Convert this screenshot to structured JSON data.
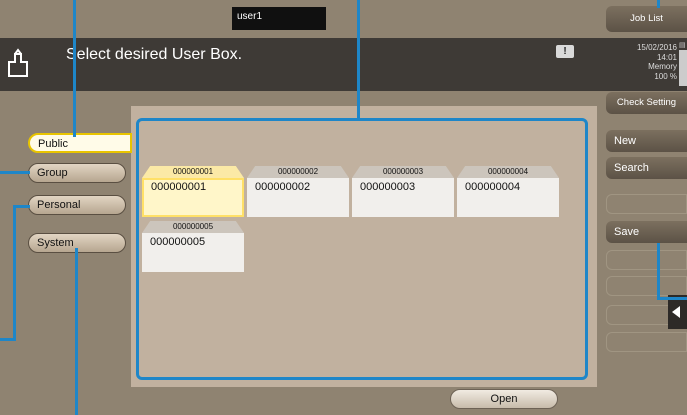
{
  "top": {
    "user": "user1",
    "job_list": "Job List"
  },
  "header": {
    "title": "Select desired User Box.",
    "alert": "!",
    "date": "15/02/2016",
    "time": "14:01",
    "memory_label": "Memory",
    "memory_value": "100 %",
    "memory_level": 1.0
  },
  "check_setting": "Check Setting",
  "tabs": [
    {
      "label": "Public",
      "active": true
    },
    {
      "label": "Group"
    },
    {
      "label": "Personal"
    },
    {
      "label": "System"
    }
  ],
  "boxes": [
    {
      "tab": "000000001",
      "name": "000000001",
      "selected": true
    },
    {
      "tab": "000000002",
      "name": "000000002"
    },
    {
      "tab": "000000003",
      "name": "000000003"
    },
    {
      "tab": "000000004",
      "name": "000000004"
    },
    {
      "tab": "000000005",
      "name": "000000005"
    }
  ],
  "open_button": "Open",
  "right_menu": {
    "new": "New",
    "search": "Search",
    "save": "Save"
  },
  "colors": {
    "accent": "#1e86c8",
    "selected": "#fff6c9",
    "header": "#3e3a36"
  }
}
